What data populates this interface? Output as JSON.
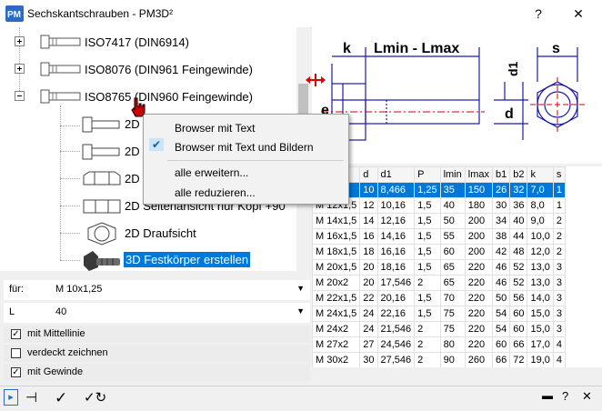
{
  "window": {
    "title": "Sechskantschrauben   -   PM3D²",
    "help_label": "?",
    "close_label": "✕"
  },
  "tree": {
    "items": [
      {
        "label": "ISO7417 (DIN6914)",
        "expander": "+"
      },
      {
        "label": "ISO8076 (DIN961 Feingewinde)",
        "expander": "+"
      },
      {
        "label": "ISO8765 (DIN960 Feingewinde)",
        "expander": "-"
      }
    ],
    "children": [
      {
        "label": "2D"
      },
      {
        "label": "2D"
      },
      {
        "label": "2D"
      },
      {
        "label": "2D Seitenansicht nur Kopf +90"
      },
      {
        "label": "2D Draufsicht"
      },
      {
        "label": "3D Festkörper erstellen",
        "selected": true
      }
    ]
  },
  "context_menu": {
    "items": [
      {
        "label": "Browser mit Text",
        "checked": false
      },
      {
        "label": "Browser mit Text und Bildern",
        "checked": true
      },
      {
        "label": "alle erweitern..."
      },
      {
        "label": "alle reduzieren..."
      }
    ]
  },
  "properties": {
    "fuer_label": "für:",
    "fuer_value": "M 10x1,25",
    "l_label": "L",
    "l_value": "40",
    "checkboxes": [
      {
        "label": "mit Mittellinie",
        "checked": true
      },
      {
        "label": "verdeckt zeichnen",
        "checked": false
      },
      {
        "label": "mit Gewinde",
        "checked": true
      }
    ]
  },
  "drawing": {
    "labels": {
      "k": "k",
      "lmin": "Lmin - Lmax",
      "s": "s",
      "d1": "d1",
      "d": "d",
      "e": "e"
    }
  },
  "table": {
    "headers": [
      "",
      "d",
      "d1",
      "P",
      "lmin",
      "lmax",
      "b1",
      "b2",
      "k",
      "s"
    ],
    "rows": [
      [
        "1,25",
        "10",
        "8,466",
        "1,25",
        "35",
        "150",
        "26",
        "32",
        "7,0",
        "1"
      ],
      [
        "M 12x1,5",
        "12",
        "10,16",
        "1,5",
        "40",
        "180",
        "30",
        "36",
        "8,0",
        "1"
      ],
      [
        "M 14x1,5",
        "14",
        "12,16",
        "1,5",
        "50",
        "200",
        "34",
        "40",
        "9,0",
        "2"
      ],
      [
        "M 16x1,5",
        "16",
        "14,16",
        "1,5",
        "55",
        "200",
        "38",
        "44",
        "10,0",
        "2"
      ],
      [
        "M 18x1,5",
        "18",
        "16,16",
        "1,5",
        "60",
        "200",
        "42",
        "48",
        "12,0",
        "2"
      ],
      [
        "M 20x1,5",
        "20",
        "18,16",
        "1,5",
        "65",
        "220",
        "46",
        "52",
        "13,0",
        "3"
      ],
      [
        "M 20x2",
        "20",
        "17,546",
        "2",
        "65",
        "220",
        "46",
        "52",
        "13,0",
        "3"
      ],
      [
        "M 22x1,5",
        "22",
        "20,16",
        "1,5",
        "70",
        "220",
        "50",
        "56",
        "14,0",
        "3"
      ],
      [
        "M 24x1,5",
        "24",
        "22,16",
        "1,5",
        "75",
        "220",
        "54",
        "60",
        "15,0",
        "3"
      ],
      [
        "M 24x2",
        "24",
        "21,546",
        "2",
        "75",
        "220",
        "54",
        "60",
        "15,0",
        "3"
      ],
      [
        "M 27x2",
        "27",
        "24,546",
        "2",
        "80",
        "220",
        "60",
        "66",
        "17,0",
        "4"
      ],
      [
        "M 30x2",
        "30",
        "27,546",
        "2",
        "90",
        "260",
        "66",
        "72",
        "19,0",
        "4"
      ]
    ]
  },
  "colors": {
    "accent": "#0078d7",
    "drawing_lines": "#1a1aa6",
    "center_line": "#cc0000"
  }
}
